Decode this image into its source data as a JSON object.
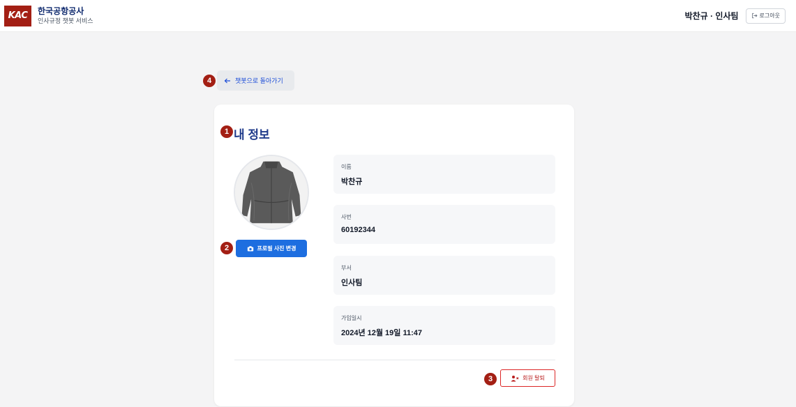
{
  "header": {
    "logo_text": "KAC",
    "brand_title": "한국공항공사",
    "brand_subtitle": "인사규정 챗봇 서비스",
    "user_info": "박찬규 · 인사팀",
    "logout_label": "로그아웃",
    "logout_icon": "logout-icon"
  },
  "annotations": {
    "badge_1": "1",
    "badge_2": "2",
    "badge_3": "3",
    "badge_4": "4"
  },
  "back": {
    "label": "챗봇으로 돌아가기",
    "icon": "arrow-left-icon"
  },
  "profile": {
    "title": "내 정보",
    "avatar_alt": "profile-photo",
    "change_photo_label": "프로필 사진 변경",
    "change_photo_icon": "camera-icon",
    "fields": [
      {
        "label": "이름",
        "value": "박찬규"
      },
      {
        "label": "사번",
        "value": "60192344"
      },
      {
        "label": "부서",
        "value": "인사팀"
      },
      {
        "label": "가입일시",
        "value": "2024년 12월 19일 11:47"
      }
    ],
    "withdraw_label": "회원 탈퇴",
    "withdraw_icon": "user-remove-icon"
  },
  "colors": {
    "brand_red": "#a31f14",
    "primary_blue": "#1d6ee0",
    "title_navy": "#1e3a8a",
    "danger": "#dc2626"
  }
}
